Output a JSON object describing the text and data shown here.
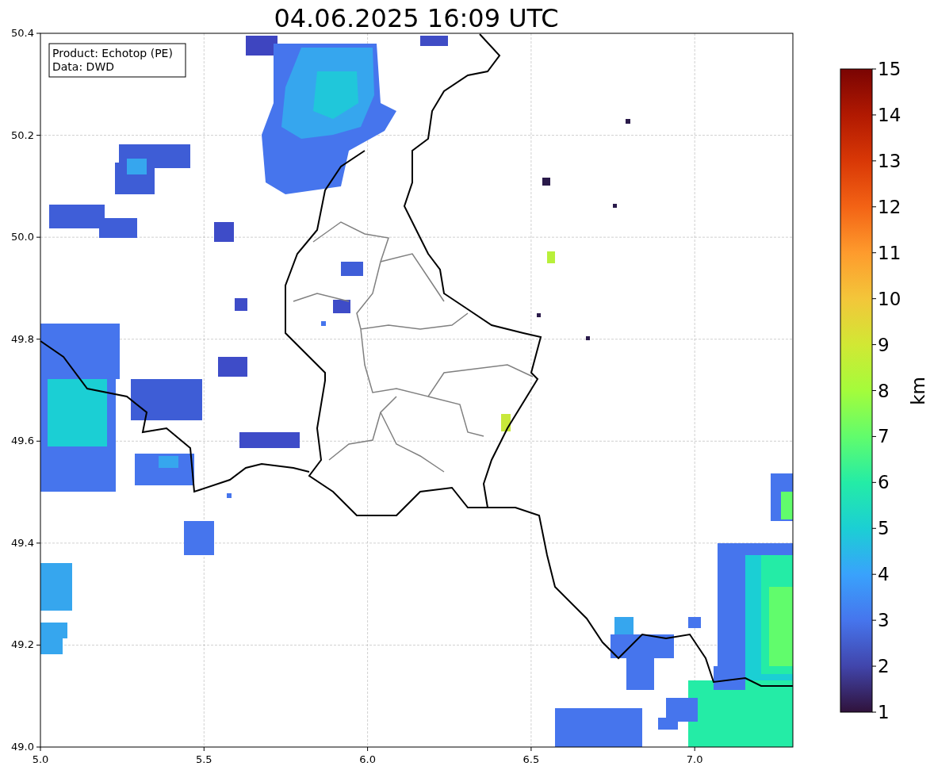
{
  "title": "04.06.2025 16:09 UTC",
  "legend": [
    "Product: Echotop (PE)",
    "Data: DWD"
  ],
  "x_ticks": [
    "5.0",
    "5.5",
    "6.0",
    "6.5",
    "7.0"
  ],
  "y_ticks": [
    "50.4",
    "50.2",
    "50.0",
    "49.8",
    "49.6",
    "49.4",
    "49.2",
    "49.0"
  ],
  "colorbar": {
    "label": "km",
    "ticks": [
      "15",
      "14",
      "13",
      "12",
      "11",
      "10",
      "9",
      "8",
      "7",
      "6",
      "5",
      "4",
      "3",
      "2",
      "1"
    ]
  }
}
